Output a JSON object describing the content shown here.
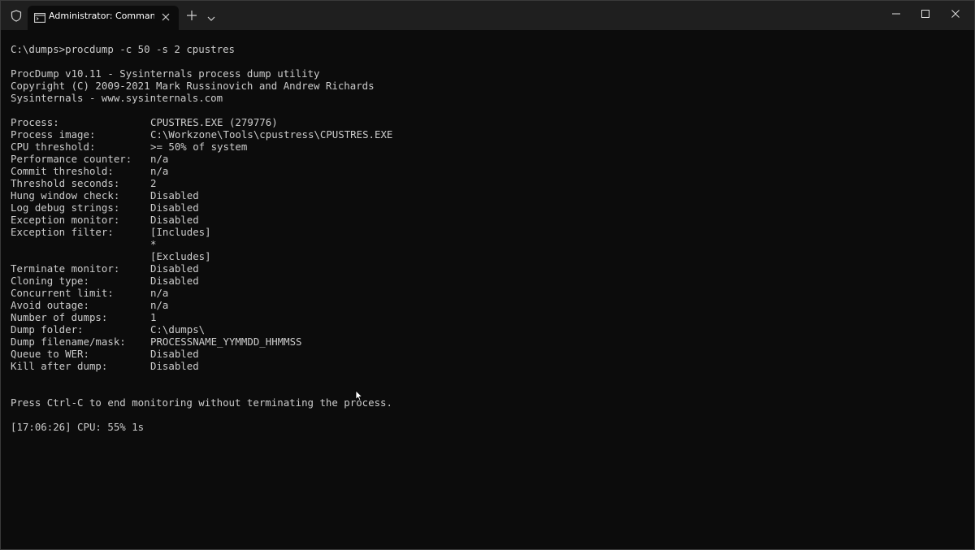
{
  "window": {
    "tab_title": "Administrator: Command Pro",
    "icons": {
      "shield": "shield-icon",
      "terminal": "terminal-icon",
      "close_tab": "close-icon",
      "new_tab": "plus-icon",
      "dropdown": "chevron-down-icon",
      "minimize": "minimize-icon",
      "maximize": "maximize-icon",
      "close": "close-icon"
    },
    "colors": {
      "background": "#0c0c0c",
      "titlebar": "#1f1f1f",
      "text": "#cccccc"
    }
  },
  "terminal": {
    "command_line": "C:\\dumps>procdump -c 50 -s 2 cpustres",
    "banner": [
      "ProcDump v10.11 - Sysinternals process dump utility",
      "Copyright (C) 2009-2021 Mark Russinovich and Andrew Richards",
      "Sysinternals - www.sysinternals.com"
    ],
    "settings": [
      {
        "key": "Process:",
        "value": "CPUSTRES.EXE (279776)"
      },
      {
        "key": "Process image:",
        "value": "C:\\Workzone\\Tools\\cpustress\\CPUSTRES.EXE"
      },
      {
        "key": "CPU threshold:",
        "value": ">= 50% of system"
      },
      {
        "key": "Performance counter:",
        "value": "n/a"
      },
      {
        "key": "Commit threshold:",
        "value": "n/a"
      },
      {
        "key": "Threshold seconds:",
        "value": "2"
      },
      {
        "key": "Hung window check:",
        "value": "Disabled"
      },
      {
        "key": "Log debug strings:",
        "value": "Disabled"
      },
      {
        "key": "Exception monitor:",
        "value": "Disabled"
      },
      {
        "key": "Exception filter:",
        "value": "[Includes]"
      },
      {
        "key": "",
        "value": "*"
      },
      {
        "key": "",
        "value": "[Excludes]"
      },
      {
        "key": "Terminate monitor:",
        "value": "Disabled"
      },
      {
        "key": "Cloning type:",
        "value": "Disabled"
      },
      {
        "key": "Concurrent limit:",
        "value": "n/a"
      },
      {
        "key": "Avoid outage:",
        "value": "n/a"
      },
      {
        "key": "Number of dumps:",
        "value": "1"
      },
      {
        "key": "Dump folder:",
        "value": "C:\\dumps\\"
      },
      {
        "key": "Dump filename/mask:",
        "value": "PROCESSNAME_YYMMDD_HHMMSS"
      },
      {
        "key": "Queue to WER:",
        "value": "Disabled"
      },
      {
        "key": "Kill after dump:",
        "value": "Disabled"
      }
    ],
    "press_message": "Press Ctrl-C to end monitoring without terminating the process.",
    "status_line": "[17:06:26] CPU: 55% 1s"
  }
}
